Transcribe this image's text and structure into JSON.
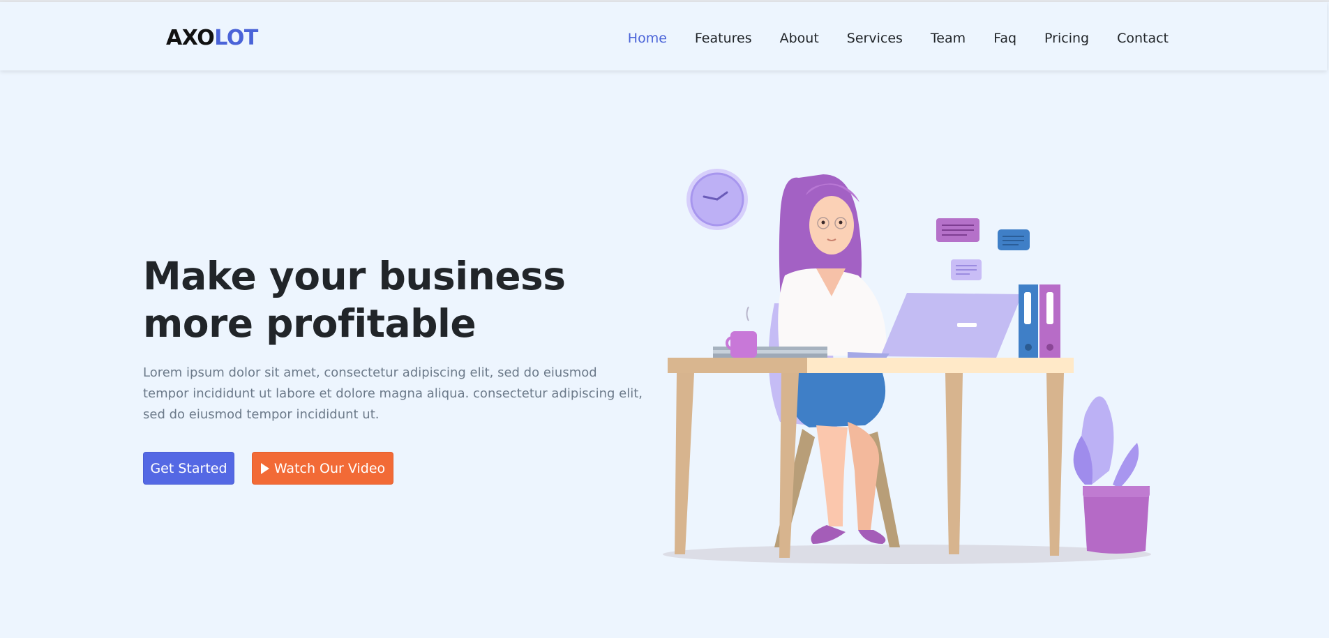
{
  "brand": {
    "part1": "AXO",
    "part2": "LOT"
  },
  "nav": {
    "items": [
      {
        "label": "Home",
        "active": true
      },
      {
        "label": "Features",
        "active": false
      },
      {
        "label": "About",
        "active": false
      },
      {
        "label": "Services",
        "active": false
      },
      {
        "label": "Team",
        "active": false
      },
      {
        "label": "Faq",
        "active": false
      },
      {
        "label": "Pricing",
        "active": false
      },
      {
        "label": "Contact",
        "active": false
      }
    ]
  },
  "hero": {
    "title": "Make your business more profitable",
    "text": "Lorem ipsum dolor sit amet, consectetur adipiscing elit, sed do eiusmod tempor incididunt ut labore et dolore magna aliqua. consectetur adipiscing elit, sed do eiusmod tempor incididunt ut.",
    "primary_button": "Get Started",
    "video_button": "Watch Our Video"
  },
  "icons": {
    "video_button": "play-icon",
    "illustration": "woman-at-desk-illustration"
  },
  "colors": {
    "background": "#edf5fe",
    "accent": "#4a63d8",
    "primary_button": "#5468e4",
    "video_button": "#f26a36",
    "text_muted": "#6c7a8a"
  }
}
